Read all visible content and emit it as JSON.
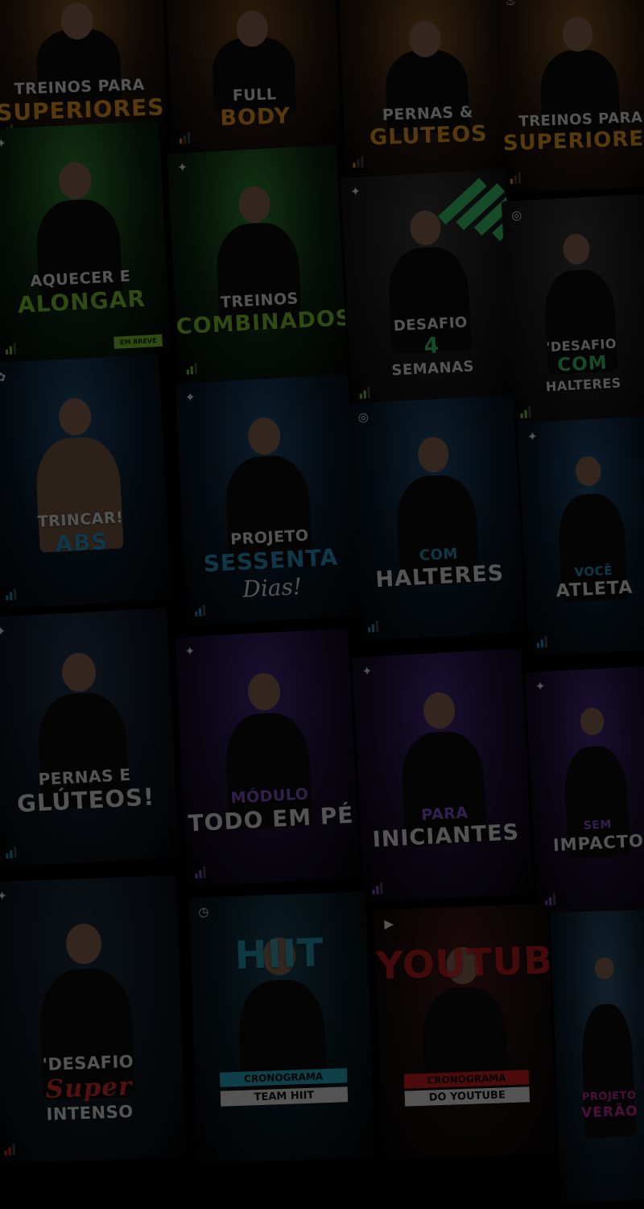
{
  "background": {
    "color": "#000000",
    "dim_color": "#000000"
  },
  "cards": [
    {
      "id": "treinos-superiores-1",
      "line1": "TREINOS PARA",
      "line2": "SUPERIORES",
      "line3": "",
      "line1_color": "#e8e8e8",
      "line2_color": "#f0a020",
      "bg": "#2a1a10",
      "glow": "#8a5a20",
      "person": "shirt",
      "icon": "",
      "icon_name": "",
      "level": "low",
      "badge": ""
    },
    {
      "id": "full-body",
      "line1": "FULL",
      "line2": "BODY",
      "line3": "",
      "line1_color": "#e8e8e8",
      "line2_color": "#f0a020",
      "bg": "#2a1a10",
      "glow": "#7a4a18",
      "person": "shirt",
      "icon": "",
      "icon_name": "",
      "level": "low",
      "badge": ""
    },
    {
      "id": "pernas-gluteos-1",
      "line1": "PERNAS &",
      "line2": "GLUTEOS",
      "line3": "",
      "line1_color": "#e8e8e8",
      "line2_color": "#f0a020",
      "bg": "#2a1a10",
      "glow": "#8a5a20",
      "person": "shirt",
      "icon": "",
      "icon_name": "",
      "level": "low",
      "badge": ""
    },
    {
      "id": "treinos-superiores-2",
      "line1": "TREINOS PARA",
      "line2": "SUPERIORES",
      "line3": "",
      "line1_color": "#e8e8e8",
      "line2_color": "#f0a020",
      "bg": "#2a1a10",
      "glow": "#8a5a20",
      "person": "shirt",
      "icon": "♨",
      "icon_name": "gym-icon",
      "level": "low",
      "badge": ""
    },
    {
      "id": "aquecer-alongar",
      "line1": "AQUECER E",
      "line2": "ALONGAR",
      "line3": "",
      "line1_color": "#e8e8e8",
      "line2_color": "#7fd030",
      "bg": "#0f2a12",
      "glow": "#2f8a30",
      "person": "shirt",
      "icon": "✦",
      "icon_name": "stretch-icon",
      "level": "mid",
      "badge": "EM BREVE"
    },
    {
      "id": "treinos-combinados",
      "line1": "TREINOS",
      "line2": "COMBINADOS",
      "line3": "",
      "line1_color": "#e8e8e8",
      "line2_color": "#7fd030",
      "bg": "#0f2a12",
      "glow": "#2f8a30",
      "person": "shirt",
      "icon": "✦",
      "icon_name": "stretch-icon",
      "level": "mid",
      "badge": ""
    },
    {
      "id": "desafio-4-semanas",
      "line1": "DESAFIO",
      "line2": "4",
      "line3": "SEMANAS",
      "line1_color": "#e8e8e8",
      "line2_color": "#3ad06a",
      "bg": "#1c1c1c",
      "glow": "#3a3a3a",
      "person": "shirt",
      "icon": "✦",
      "icon_name": "stretch-icon",
      "level": "mid",
      "badge": ""
    },
    {
      "id": "desafio-com-halteres",
      "line1": "'DESAFIO",
      "line2": "COM",
      "line3": "HALTERES",
      "line1_color": "#e8e8e8",
      "line2_color": "#3ad06a",
      "bg": "#1c1c1c",
      "glow": "#3a3a3a",
      "person": "shirt",
      "icon": "◎",
      "icon_name": "timer-icon",
      "level": "mid",
      "badge": ""
    },
    {
      "id": "trincar-abs",
      "line1": "TRINCAR!",
      "line2": "ABS",
      "line3": "",
      "line1_color": "#e8e8e8",
      "line2_color": "#2a9ac8",
      "bg": "#0b1c2a",
      "glow": "#1f4f78",
      "person": "bare",
      "icon": "✿",
      "icon_name": "abs-icon",
      "level": "high",
      "badge": ""
    },
    {
      "id": "projeto-sessenta-dias",
      "line1": "PROJETO",
      "line2": "SESSENTA",
      "line3": "Dias!",
      "line1_color": "#e8e8e8",
      "line2_color": "#2a9ac8",
      "bg": "#0b1c2a",
      "glow": "#1f4f78",
      "person": "shirt",
      "icon": "✦",
      "icon_name": "stretch-icon",
      "level": "high",
      "badge": ""
    },
    {
      "id": "com-halteres",
      "line1": "COM",
      "line2": "HALTERES",
      "line3": "",
      "line1_color": "#2a9ac8",
      "line2_color": "#e8e8e8",
      "bg": "#0b1c2a",
      "glow": "#1f4f78",
      "person": "shirt",
      "icon": "◎",
      "icon_name": "timer-icon",
      "level": "high",
      "badge": ""
    },
    {
      "id": "voce-atleta",
      "line1": "VOCÊ",
      "line2": "ATLETA",
      "line3": "",
      "line1_color": "#2a9ac8",
      "line2_color": "#e8e8e8",
      "bg": "#0b1c2a",
      "glow": "#1f4f78",
      "person": "shirt",
      "icon": "✦",
      "icon_name": "stretch-icon",
      "level": "high",
      "badge": ""
    },
    {
      "id": "pernas-gluteos-2",
      "line1": "PERNAS E",
      "line2": "GLÚTEOS!",
      "line3": "",
      "line1_color": "#e8e8e8",
      "line2_color": "#e8e8e8",
      "bg": "#101a26",
      "glow": "#243a52",
      "person": "shirt",
      "icon": "✦",
      "icon_name": "stretch-icon",
      "level": "high",
      "badge": ""
    },
    {
      "id": "modulo-todo-em-pe",
      "line1": "MÓDULO",
      "line2": "TODO EM PÉ",
      "line3": "",
      "line1_color": "#8a5ad8",
      "line2_color": "#e8e8e8",
      "bg": "#1a1030",
      "glow": "#4a2a8a",
      "person": "shirt",
      "icon": "✦",
      "icon_name": "stretch-icon",
      "level": "purple",
      "badge": ""
    },
    {
      "id": "para-iniciantes",
      "line1": "PARA",
      "line2": "INICIANTES",
      "line3": "",
      "line1_color": "#8a5ad8",
      "line2_color": "#e8e8e8",
      "bg": "#1a1030",
      "glow": "#4a2a8a",
      "person": "shirt",
      "icon": "✦",
      "icon_name": "stretch-icon",
      "level": "purple",
      "badge": ""
    },
    {
      "id": "sem-impacto",
      "line1": "SEM",
      "line2": "IMPACTO",
      "line3": "",
      "line1_color": "#8a5ad8",
      "line2_color": "#e8e8e8",
      "bg": "#1a1030",
      "glow": "#4a2a8a",
      "person": "shirt",
      "icon": "✦",
      "icon_name": "stretch-icon",
      "level": "purple",
      "badge": ""
    },
    {
      "id": "desafio-super-intenso",
      "line1": "'DESAFIO",
      "line2": "Super",
      "line3": "INTENSO",
      "line1_color": "#e8e8e8",
      "line2_color": "#e23030",
      "bg": "#0f1a24",
      "glow": "#1f2f40",
      "person": "shirt",
      "icon": "✦",
      "icon_name": "stretch-icon",
      "level": "red",
      "badge": ""
    },
    {
      "id": "cronograma-team-hiit",
      "line1": "HIIT",
      "line2": "CRONOGRAMA",
      "line3": "TEAM HIIT",
      "line1_color": "#2ab0c8",
      "line2_color": "#2ab0c8",
      "bg": "#0a1a22",
      "glow": "#1c4a5a",
      "person": "shirt",
      "icon": "◷",
      "icon_name": "clock-icon",
      "level": "",
      "badge": ""
    },
    {
      "id": "cronograma-youtube",
      "line1": "YOUTUBE",
      "line2": "CRONOGRAMA",
      "line3": "DO YOUTUBE",
      "line1_color": "#d42020",
      "line2_color": "#d42020",
      "bg": "#1a0d0d",
      "glow": "#4a1a1a",
      "person": "shirt",
      "icon": "▶",
      "icon_name": "youtube-icon",
      "level": "",
      "badge": ""
    },
    {
      "id": "projeto-verao",
      "line1": "PROJETO",
      "line2": "VERÃO",
      "line3": "",
      "line1_color": "#d02aa0",
      "line2_color": "#d02aa0",
      "bg": "#0f2030",
      "glow": "#2f5a7a",
      "person": "shirt",
      "icon": "",
      "icon_name": "",
      "level": "",
      "badge": ""
    }
  ]
}
